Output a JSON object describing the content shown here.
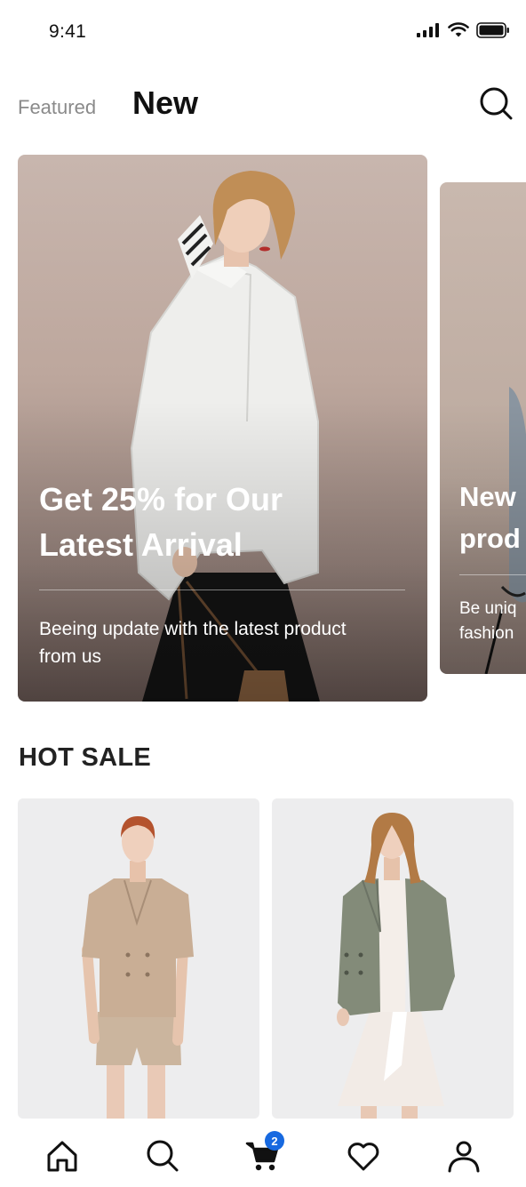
{
  "status_bar": {
    "time": "9:41"
  },
  "header": {
    "tabs": [
      {
        "label": "Featured",
        "active": false
      },
      {
        "label": "New",
        "active": true
      }
    ]
  },
  "banners": [
    {
      "title_line1": "Get 25% for Our",
      "title_line2": "Latest Arrival",
      "subtitle_line1": "Beeing update with the latest product",
      "subtitle_line2": "from us"
    },
    {
      "title_line1": "New",
      "title_line2": "prod",
      "subtitle_line1": "Be uniq",
      "subtitle_line2": "fashion"
    }
  ],
  "hot_sale": {
    "title": "HOT SALE"
  },
  "tabbar": {
    "items": [
      {
        "name": "home",
        "icon": "home-icon"
      },
      {
        "name": "search",
        "icon": "search-icon"
      },
      {
        "name": "cart",
        "icon": "cart-icon",
        "badge": "2"
      },
      {
        "name": "favorites",
        "icon": "heart-icon"
      },
      {
        "name": "profile",
        "icon": "user-icon"
      }
    ]
  },
  "colors": {
    "accent": "#1769e0",
    "text": "#111111",
    "muted": "#8a8a8a",
    "card_bg": "#ededee"
  }
}
